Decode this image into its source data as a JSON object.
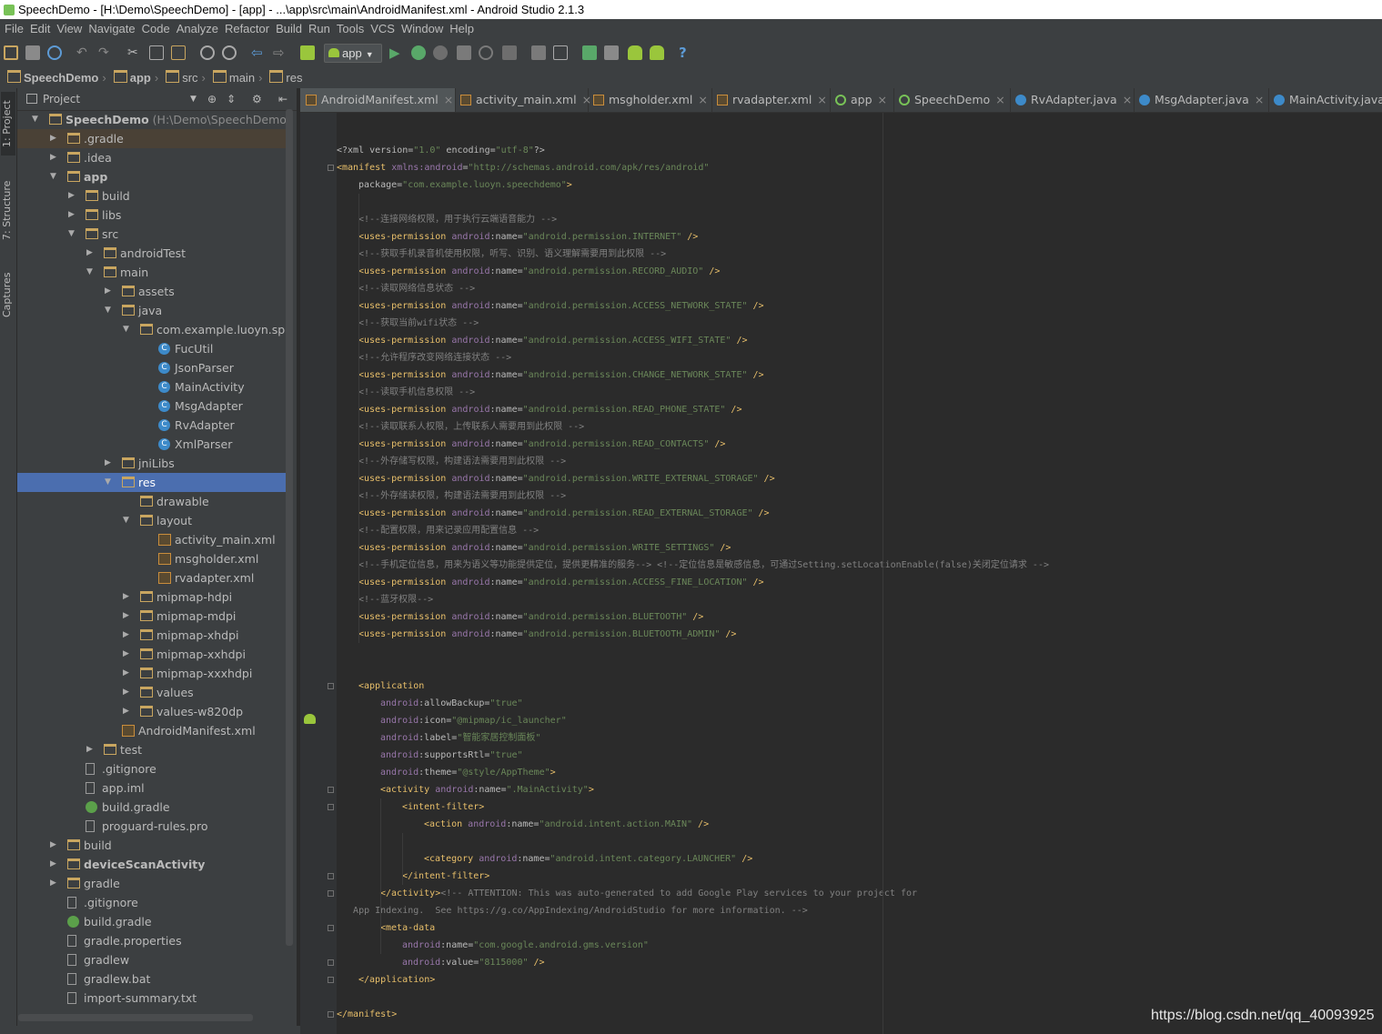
{
  "window": {
    "title": "SpeechDemo - [H:\\Demo\\SpeechDemo] - [app] - ...\\app\\src\\main\\AndroidManifest.xml - Android Studio 2.1.3"
  },
  "menu": [
    "File",
    "Edit",
    "View",
    "Navigate",
    "Code",
    "Analyze",
    "Refactor",
    "Build",
    "Run",
    "Tools",
    "VCS",
    "Window",
    "Help"
  ],
  "toolbar": {
    "run_config": "app",
    "help": "?"
  },
  "breadcrumbs": [
    "SpeechDemo",
    "app",
    "src",
    "main",
    "res"
  ],
  "tool_windows": {
    "project": "1: Project",
    "structure": "7: Structure",
    "captures": "Captures"
  },
  "panel": {
    "title": "Project"
  },
  "tree": [
    {
      "label": "SpeechDemo",
      "suffix": "(H:\\Demo\\SpeechDemo)",
      "depth": 0,
      "icon": "folder",
      "arrow": "open",
      "bold": true
    },
    {
      "label": ".gradle",
      "depth": 1,
      "icon": "folder",
      "arrow": "closed",
      "hl": true
    },
    {
      "label": ".idea",
      "depth": 1,
      "icon": "folder",
      "arrow": "closed"
    },
    {
      "label": "app",
      "depth": 1,
      "icon": "folder",
      "arrow": "open",
      "bold": true
    },
    {
      "label": "build",
      "depth": 2,
      "icon": "folder",
      "arrow": "closed"
    },
    {
      "label": "libs",
      "depth": 2,
      "icon": "folder",
      "arrow": "closed"
    },
    {
      "label": "src",
      "depth": 2,
      "icon": "folder",
      "arrow": "open"
    },
    {
      "label": "androidTest",
      "depth": 3,
      "icon": "folder",
      "arrow": "closed"
    },
    {
      "label": "main",
      "depth": 3,
      "icon": "folder",
      "arrow": "open"
    },
    {
      "label": "assets",
      "depth": 4,
      "icon": "folder",
      "arrow": "closed"
    },
    {
      "label": "java",
      "depth": 4,
      "icon": "folder",
      "arrow": "open"
    },
    {
      "label": "com.example.luoyn.speech",
      "depth": 5,
      "icon": "folder",
      "arrow": "open"
    },
    {
      "label": "FucUtil",
      "depth": 6,
      "icon": "cls"
    },
    {
      "label": "JsonParser",
      "depth": 6,
      "icon": "cls"
    },
    {
      "label": "MainActivity",
      "depth": 6,
      "icon": "cls"
    },
    {
      "label": "MsgAdapter",
      "depth": 6,
      "icon": "cls"
    },
    {
      "label": "RvAdapter",
      "depth": 6,
      "icon": "cls"
    },
    {
      "label": "XmlParser",
      "depth": 6,
      "icon": "cls"
    },
    {
      "label": "jniLibs",
      "depth": 4,
      "icon": "folder",
      "arrow": "closed"
    },
    {
      "label": "res",
      "depth": 4,
      "icon": "folder",
      "arrow": "open",
      "sel": true
    },
    {
      "label": "drawable",
      "depth": 5,
      "icon": "folder"
    },
    {
      "label": "layout",
      "depth": 5,
      "icon": "folder",
      "arrow": "open"
    },
    {
      "label": "activity_main.xml",
      "depth": 6,
      "icon": "xml"
    },
    {
      "label": "msgholder.xml",
      "depth": 6,
      "icon": "xml"
    },
    {
      "label": "rvadapter.xml",
      "depth": 6,
      "icon": "xml"
    },
    {
      "label": "mipmap-hdpi",
      "depth": 5,
      "icon": "folder",
      "arrow": "closed"
    },
    {
      "label": "mipmap-mdpi",
      "depth": 5,
      "icon": "folder",
      "arrow": "closed"
    },
    {
      "label": "mipmap-xhdpi",
      "depth": 5,
      "icon": "folder",
      "arrow": "closed"
    },
    {
      "label": "mipmap-xxhdpi",
      "depth": 5,
      "icon": "folder",
      "arrow": "closed"
    },
    {
      "label": "mipmap-xxxhdpi",
      "depth": 5,
      "icon": "folder",
      "arrow": "closed"
    },
    {
      "label": "values",
      "depth": 5,
      "icon": "folder",
      "arrow": "closed"
    },
    {
      "label": "values-w820dp",
      "depth": 5,
      "icon": "folder",
      "arrow": "closed"
    },
    {
      "label": "AndroidManifest.xml",
      "depth": 4,
      "icon": "xml"
    },
    {
      "label": "test",
      "depth": 3,
      "icon": "folder",
      "arrow": "closed"
    },
    {
      "label": ".gitignore",
      "depth": 2,
      "icon": "file"
    },
    {
      "label": "app.iml",
      "depth": 2,
      "icon": "file"
    },
    {
      "label": "build.gradle",
      "depth": 2,
      "icon": "gradle"
    },
    {
      "label": "proguard-rules.pro",
      "depth": 2,
      "icon": "file"
    },
    {
      "label": "build",
      "depth": 1,
      "icon": "folder",
      "arrow": "closed"
    },
    {
      "label": "deviceScanActivity",
      "depth": 1,
      "icon": "folder",
      "arrow": "closed",
      "bold": true
    },
    {
      "label": "gradle",
      "depth": 1,
      "icon": "folder",
      "arrow": "closed"
    },
    {
      "label": ".gitignore",
      "depth": 1,
      "icon": "file"
    },
    {
      "label": "build.gradle",
      "depth": 1,
      "icon": "gradle"
    },
    {
      "label": "gradle.properties",
      "depth": 1,
      "icon": "file"
    },
    {
      "label": "gradlew",
      "depth": 1,
      "icon": "file"
    },
    {
      "label": "gradlew.bat",
      "depth": 1,
      "icon": "file"
    },
    {
      "label": "import-summary.txt",
      "depth": 1,
      "icon": "file"
    }
  ],
  "tabs": [
    {
      "label": "AndroidManifest.xml",
      "icon": "xml",
      "active": true
    },
    {
      "label": "activity_main.xml",
      "icon": "xml"
    },
    {
      "label": "msgholder.xml",
      "icon": "xml"
    },
    {
      "label": "rvadapter.xml",
      "icon": "xml"
    },
    {
      "label": "app",
      "icon": "gr"
    },
    {
      "label": "SpeechDemo",
      "icon": "gr"
    },
    {
      "label": "RvAdapter.java",
      "icon": "cls"
    },
    {
      "label": "MsgAdapter.java",
      "icon": "cls"
    },
    {
      "label": "MainActivity.java",
      "icon": "cls"
    }
  ],
  "code": [
    {
      "indent": 0,
      "tokens": [
        [
          "a",
          "<?xml "
        ],
        [
          "a",
          "version="
        ],
        [
          "v",
          "\"1.0\""
        ],
        [
          "a",
          " encoding="
        ],
        [
          "v",
          "\"utf-8\""
        ],
        [
          "a",
          "?>"
        ]
      ]
    },
    {
      "indent": 0,
      "tokens": [
        [
          "t",
          "<manifest "
        ],
        [
          "ns",
          "xmlns:android"
        ],
        [
          "a",
          "="
        ],
        [
          "v",
          "\"http://schemas.android.com/apk/res/android\""
        ]
      ]
    },
    {
      "indent": 1,
      "tokens": [
        [
          "a",
          "package="
        ],
        [
          "v",
          "\"com.example.luoyn.speechdemo\""
        ],
        [
          "t",
          ">"
        ]
      ]
    },
    {
      "indent": 0,
      "tokens": []
    },
    {
      "indent": 1,
      "tokens": [
        [
          "c",
          "<!--连接网络权限，用于执行云端语音能力 -->"
        ]
      ]
    },
    {
      "indent": 1,
      "tokens": [
        [
          "t",
          "<uses-permission "
        ],
        [
          "ns",
          "android"
        ],
        [
          "a",
          ":name="
        ],
        [
          "v",
          "\"android.permission.INTERNET\""
        ],
        [
          "t",
          " />"
        ]
      ]
    },
    {
      "indent": 1,
      "tokens": [
        [
          "c",
          "<!--获取手机录音机使用权限，听写、识别、语义理解需要用到此权限 -->"
        ]
      ]
    },
    {
      "indent": 1,
      "tokens": [
        [
          "t",
          "<uses-permission "
        ],
        [
          "ns",
          "android"
        ],
        [
          "a",
          ":name="
        ],
        [
          "v",
          "\"android.permission.RECORD_AUDIO\""
        ],
        [
          "t",
          " />"
        ]
      ]
    },
    {
      "indent": 1,
      "tokens": [
        [
          "c",
          "<!--读取网络信息状态 -->"
        ]
      ]
    },
    {
      "indent": 1,
      "tokens": [
        [
          "t",
          "<uses-permission "
        ],
        [
          "ns",
          "android"
        ],
        [
          "a",
          ":name="
        ],
        [
          "v",
          "\"android.permission.ACCESS_NETWORK_STATE\""
        ],
        [
          "t",
          " />"
        ]
      ]
    },
    {
      "indent": 1,
      "tokens": [
        [
          "c",
          "<!--获取当前wifi状态 -->"
        ]
      ]
    },
    {
      "indent": 1,
      "tokens": [
        [
          "t",
          "<uses-permission "
        ],
        [
          "ns",
          "android"
        ],
        [
          "a",
          ":name="
        ],
        [
          "v",
          "\"android.permission.ACCESS_WIFI_STATE\""
        ],
        [
          "t",
          " />"
        ]
      ]
    },
    {
      "indent": 1,
      "tokens": [
        [
          "c",
          "<!--允许程序改变网络连接状态 -->"
        ]
      ]
    },
    {
      "indent": 1,
      "tokens": [
        [
          "t",
          "<uses-permission "
        ],
        [
          "ns",
          "android"
        ],
        [
          "a",
          ":name="
        ],
        [
          "v",
          "\"android.permission.CHANGE_NETWORK_STATE\""
        ],
        [
          "t",
          " />"
        ]
      ]
    },
    {
      "indent": 1,
      "tokens": [
        [
          "c",
          "<!--读取手机信息权限 -->"
        ]
      ]
    },
    {
      "indent": 1,
      "tokens": [
        [
          "t",
          "<uses-permission "
        ],
        [
          "ns",
          "android"
        ],
        [
          "a",
          ":name="
        ],
        [
          "v",
          "\"android.permission.READ_PHONE_STATE\""
        ],
        [
          "t",
          " />"
        ]
      ]
    },
    {
      "indent": 1,
      "tokens": [
        [
          "c",
          "<!--读取联系人权限，上传联系人需要用到此权限 -->"
        ]
      ]
    },
    {
      "indent": 1,
      "tokens": [
        [
          "t",
          "<uses-permission "
        ],
        [
          "ns",
          "android"
        ],
        [
          "a",
          ":name="
        ],
        [
          "v",
          "\"android.permission.READ_CONTACTS\""
        ],
        [
          "t",
          " />"
        ]
      ]
    },
    {
      "indent": 1,
      "tokens": [
        [
          "c",
          "<!--外存储写权限，构建语法需要用到此权限 -->"
        ]
      ]
    },
    {
      "indent": 1,
      "tokens": [
        [
          "t",
          "<uses-permission "
        ],
        [
          "ns",
          "android"
        ],
        [
          "a",
          ":name="
        ],
        [
          "v",
          "\"android.permission.WRITE_EXTERNAL_STORAGE\""
        ],
        [
          "t",
          " />"
        ]
      ]
    },
    {
      "indent": 1,
      "tokens": [
        [
          "c",
          "<!--外存储读权限，构建语法需要用到此权限 -->"
        ]
      ]
    },
    {
      "indent": 1,
      "tokens": [
        [
          "t",
          "<uses-permission "
        ],
        [
          "ns",
          "android"
        ],
        [
          "a",
          ":name="
        ],
        [
          "v",
          "\"android.permission.READ_EXTERNAL_STORAGE\""
        ],
        [
          "t",
          " />"
        ]
      ]
    },
    {
      "indent": 1,
      "tokens": [
        [
          "c",
          "<!--配置权限，用来记录应用配置信息 -->"
        ]
      ]
    },
    {
      "indent": 1,
      "tokens": [
        [
          "t",
          "<uses-permission "
        ],
        [
          "ns",
          "android"
        ],
        [
          "a",
          ":name="
        ],
        [
          "v",
          "\"android.permission.WRITE_SETTINGS\""
        ],
        [
          "t",
          " />"
        ]
      ]
    },
    {
      "indent": 1,
      "tokens": [
        [
          "c",
          "<!--手机定位信息，用来为语义等功能提供定位，提供更精准的服务--> <!--定位信息是敏感信息，可通过Setting.setLocationEnable(false)关闭定位请求 -->"
        ]
      ]
    },
    {
      "indent": 1,
      "tokens": [
        [
          "t",
          "<uses-permission "
        ],
        [
          "ns",
          "android"
        ],
        [
          "a",
          ":name="
        ],
        [
          "v",
          "\"android.permission.ACCESS_FINE_LOCATION\""
        ],
        [
          "t",
          " />"
        ]
      ]
    },
    {
      "indent": 1,
      "tokens": [
        [
          "c",
          "<!--蓝牙权限-->"
        ]
      ]
    },
    {
      "indent": 1,
      "tokens": [
        [
          "t",
          "<uses-permission "
        ],
        [
          "ns",
          "android"
        ],
        [
          "a",
          ":name="
        ],
        [
          "v",
          "\"android.permission.BLUETOOTH\""
        ],
        [
          "t",
          " />"
        ]
      ]
    },
    {
      "indent": 1,
      "tokens": [
        [
          "t",
          "<uses-permission "
        ],
        [
          "ns",
          "android"
        ],
        [
          "a",
          ":name="
        ],
        [
          "v",
          "\"android.permission.BLUETOOTH_ADMIN\""
        ],
        [
          "t",
          " />"
        ]
      ]
    },
    {
      "indent": 0,
      "tokens": []
    },
    {
      "indent": 0,
      "tokens": []
    },
    {
      "indent": 1,
      "tokens": [
        [
          "t",
          "<application"
        ]
      ]
    },
    {
      "indent": 2,
      "tokens": [
        [
          "ns",
          "android"
        ],
        [
          "a",
          ":allowBackup="
        ],
        [
          "v",
          "\"true\""
        ]
      ]
    },
    {
      "indent": 2,
      "tokens": [
        [
          "ns",
          "android"
        ],
        [
          "a",
          ":icon="
        ],
        [
          "v",
          "\"@mipmap/ic_launcher\""
        ]
      ]
    },
    {
      "indent": 2,
      "tokens": [
        [
          "ns",
          "android"
        ],
        [
          "a",
          ":label="
        ],
        [
          "v",
          "\"智能家居控制面板\""
        ]
      ]
    },
    {
      "indent": 2,
      "tokens": [
        [
          "ns",
          "android"
        ],
        [
          "a",
          ":supportsRtl="
        ],
        [
          "v",
          "\"true\""
        ]
      ]
    },
    {
      "indent": 2,
      "tokens": [
        [
          "ns",
          "android"
        ],
        [
          "a",
          ":theme="
        ],
        [
          "v",
          "\"@style/AppTheme\""
        ],
        [
          "t",
          ">"
        ]
      ]
    },
    {
      "indent": 2,
      "tokens": [
        [
          "t",
          "<activity "
        ],
        [
          "ns",
          "android"
        ],
        [
          "a",
          ":name="
        ],
        [
          "v",
          "\".MainActivity\""
        ],
        [
          "t",
          ">"
        ]
      ]
    },
    {
      "indent": 3,
      "tokens": [
        [
          "t",
          "<intent-filter>"
        ]
      ]
    },
    {
      "indent": 4,
      "tokens": [
        [
          "t",
          "<action "
        ],
        [
          "ns",
          "android"
        ],
        [
          "a",
          ":name="
        ],
        [
          "v",
          "\"android.intent.action.MAIN\""
        ],
        [
          "t",
          " />"
        ]
      ]
    },
    {
      "indent": 0,
      "tokens": []
    },
    {
      "indent": 4,
      "tokens": [
        [
          "t",
          "<category "
        ],
        [
          "ns",
          "android"
        ],
        [
          "a",
          ":name="
        ],
        [
          "v",
          "\"android.intent.category.LAUNCHER\""
        ],
        [
          "t",
          " />"
        ]
      ]
    },
    {
      "indent": 3,
      "tokens": [
        [
          "t",
          "</intent-filter>"
        ]
      ]
    },
    {
      "indent": 2,
      "tokens": [
        [
          "t",
          "</activity>"
        ],
        [
          "c",
          "<!-- ATTENTION: This was auto-generated to add Google Play services to your project for"
        ]
      ]
    },
    {
      "indent": 0,
      "tokens": [
        [
          "c",
          "   App Indexing.  See https://g.co/AppIndexing/AndroidStudio for more information. -->"
        ]
      ]
    },
    {
      "indent": 2,
      "tokens": [
        [
          "t",
          "<meta-data"
        ]
      ]
    },
    {
      "indent": 3,
      "tokens": [
        [
          "ns",
          "android"
        ],
        [
          "a",
          ":name="
        ],
        [
          "v",
          "\"com.google.android.gms.version\""
        ]
      ]
    },
    {
      "indent": 3,
      "tokens": [
        [
          "ns",
          "android"
        ],
        [
          "a",
          ":value="
        ],
        [
          "v",
          "\"8115000\""
        ],
        [
          "t",
          " />"
        ]
      ]
    },
    {
      "indent": 1,
      "tokens": [
        [
          "t",
          "</application>"
        ]
      ]
    },
    {
      "indent": 0,
      "tokens": []
    },
    {
      "indent": 0,
      "tokens": [
        [
          "t",
          "</manifest>"
        ]
      ]
    }
  ],
  "watermark": "https://blog.csdn.net/qq_40093925",
  "colors": {
    "selection": "#4b6eaf",
    "editor_bg": "#2b2b2b",
    "panel_bg": "#3c3f41",
    "tag": "#e8bf6a",
    "value": "#6a8759",
    "comment": "#808080",
    "namespace": "#9876aa"
  }
}
